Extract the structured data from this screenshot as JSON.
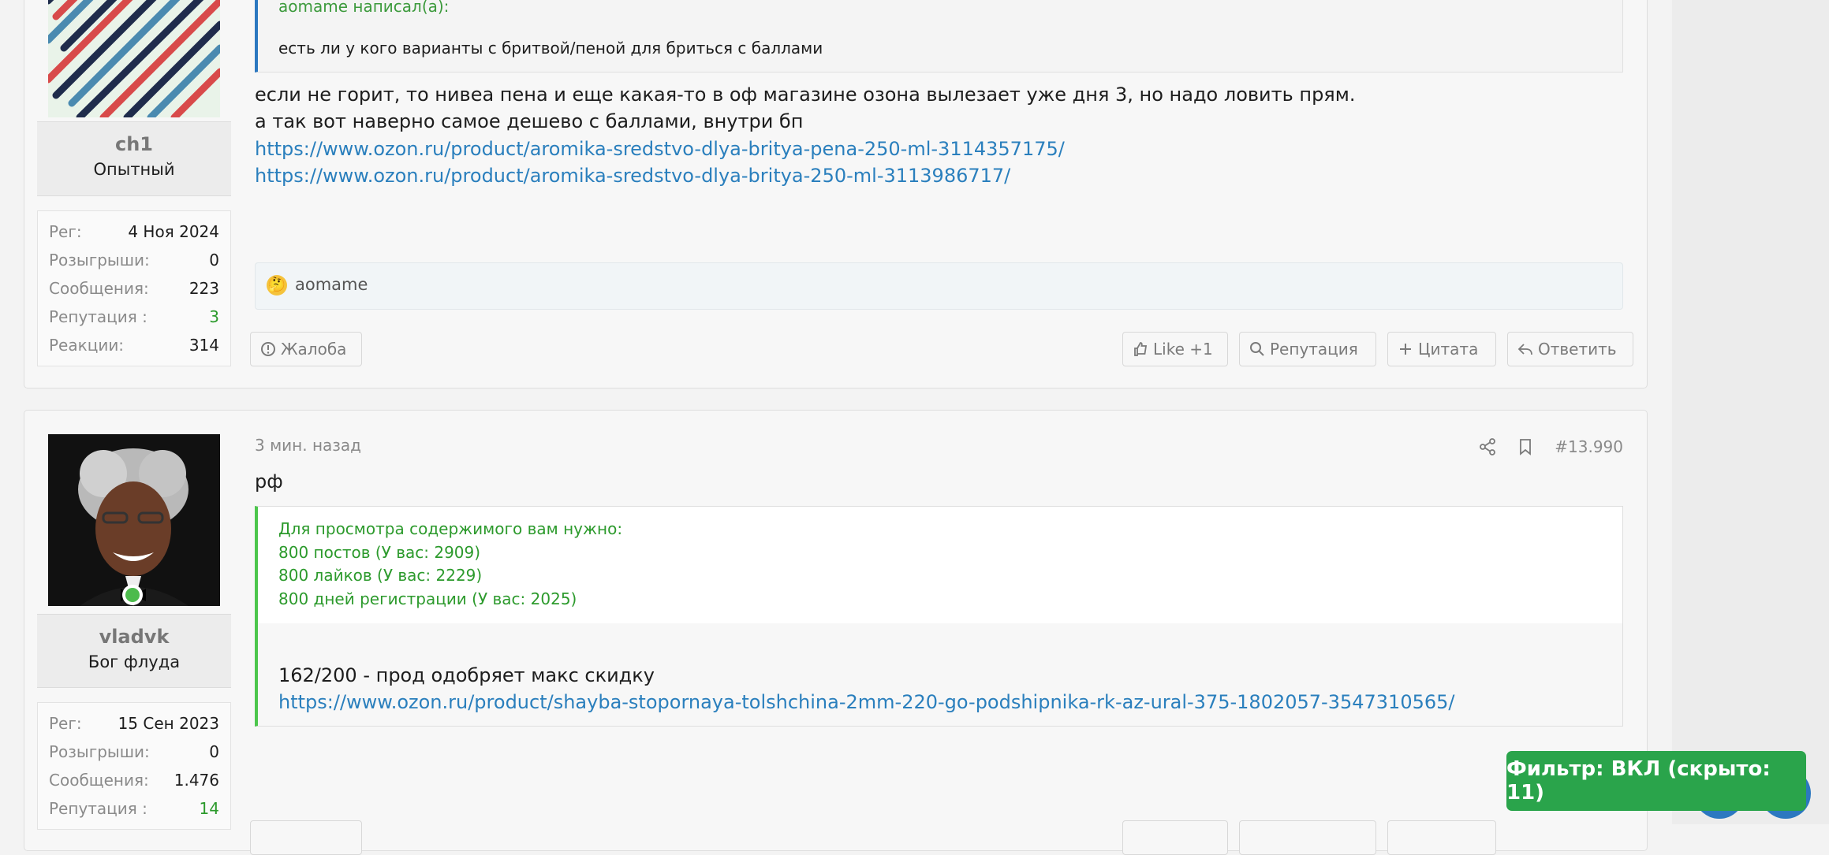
{
  "post1": {
    "user": {
      "name": "ch1",
      "title": "Опытный"
    },
    "stats": [
      {
        "label": "Рег:",
        "value": "4 Ноя 2024"
      },
      {
        "label": "Розыгрыши:",
        "value": "0"
      },
      {
        "label": "Сообщения:",
        "value": "223"
      },
      {
        "label": "Репутация :",
        "value": "3"
      },
      {
        "label": "Реакции:",
        "value": "314"
      }
    ],
    "quote": {
      "head": "aomame написал(а):",
      "text": "есть ли у кого варианты с бритвой/пеной для бриться с баллами"
    },
    "body": [
      "если не горит, то нивеа пена и еще какая-то в оф магазине озона вылезает уже дня 3, но надо ловить прям.",
      "а так вот наверно самое дешево с баллами, внутри бп"
    ],
    "links": [
      "https://www.ozon.ru/product/aromika-sredstvo-dlya-britya-pena-250-ml-3114357175/",
      "https://www.ozon.ru/product/aromika-sredstvo-dlya-britya-250-ml-3113986717/"
    ],
    "reaction_user": "aomame",
    "actions": {
      "report": "Жалоба",
      "like": "Like +1",
      "reputation": "Репутация",
      "quote": "Цитата",
      "reply": "Ответить"
    }
  },
  "post2": {
    "user": {
      "name": "vladvk",
      "title": "Бог флуда"
    },
    "stats": [
      {
        "label": "Рег:",
        "value": "15 Сен 2023"
      },
      {
        "label": "Розыгрыши:",
        "value": "0"
      },
      {
        "label": "Сообщения:",
        "value": "1.476"
      },
      {
        "label": "Репутация :",
        "value": "14"
      }
    ],
    "time": "3 мин. назад",
    "number": "#13.990",
    "body": "рф",
    "hidden": {
      "lines": [
        "Для просмотра содержимого вам нужно:",
        "800 постов (У вас: 2909)",
        "800 лайков (У вас: 2229)",
        "800 дней регистрации (У вас: 2025)"
      ],
      "text": "162/200 - прод одобряет макс скидку",
      "link": "https://www.ozon.ru/product/shayba-stopornaya-tolshchina-2mm-220-go-podshipnika-rk-az-ural-375-1802057-3547310565/"
    }
  },
  "filter": {
    "label": "Фильтр: ВКЛ (скрыто: 11)"
  },
  "colors": {
    "accent": "#2c78c0",
    "green": "#2aa44b",
    "link": "#2a7fbd"
  }
}
